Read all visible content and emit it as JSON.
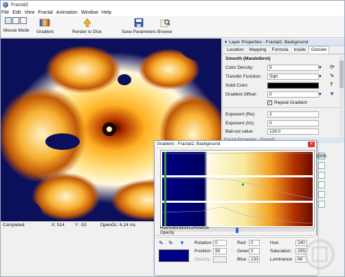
{
  "window": {
    "title": "Fractal2"
  },
  "menu": [
    "File",
    "Edit",
    "View",
    "Fractal",
    "Animation",
    "Window",
    "Help"
  ],
  "toolbar": {
    "mouse_mode": "Mouse Mode",
    "gradient": "Gradient",
    "render": "Render to Disk",
    "save_params": "Save Parameters",
    "browse": "Browse"
  },
  "status": {
    "state": "Completed",
    "x": "X: 514",
    "y": "Y: -52",
    "opengl": "OpenGL: 6.24 ms"
  },
  "layer_panel": {
    "header": "Layer Properties - Fractal2, Background",
    "tabs": [
      "Location",
      "Mapping",
      "Formula",
      "Inside",
      "Outside"
    ],
    "active_tab": "Outside",
    "section": "Smooth (Mandelbrot)",
    "color_density_label": "Color Density:",
    "color_density_value": "5",
    "transfer_function_label": "Transfer Function:",
    "transfer_function_value": "Sqrt",
    "solid_color_label": "Solid Color:",
    "gradient_offset_label": "Gradient Offset:",
    "gradient_offset_value": "0",
    "repeat_gradient_label": "Repeat Gradient",
    "exponent_re_label": "Exponent (Re):",
    "exponent_re_value": "2",
    "exponent_im_label": "Exponent (Im):",
    "exponent_im_value": "0",
    "bailout_label": "Bail-out value:",
    "bailout_value": "128.0"
  },
  "panel2": {
    "header": "Fractal Properties - Fractal2"
  },
  "gradient_window": {
    "title": "Gradient - Fractal2, Background",
    "percent": "100%",
    "mode_label": "Hue/Saturation/Luminance",
    "opacity_label": "Opacity",
    "rotation_label": "Rotation:",
    "rotation_value": "0",
    "position_label": "Position:",
    "position_value": "99",
    "opacity_field_label": "Opacity:",
    "red_label": "Red:",
    "red_value": "0",
    "green_label": "Green:",
    "green_value": "0",
    "blue_label": "Blue:",
    "blue_value": "133",
    "hue_label": "Hue:",
    "hue_value": "240",
    "saturation_label": "Saturation:",
    "saturation_value": "255",
    "luminance_label": "Luminance:",
    "luminance_value": "66",
    "current_color": "#000085"
  },
  "colors": {
    "fractal_bg": "#0c0f5a",
    "gradient_start": "#000085",
    "gradient_mid": "#f7e89a",
    "gradient_end": "#6a0a00"
  }
}
